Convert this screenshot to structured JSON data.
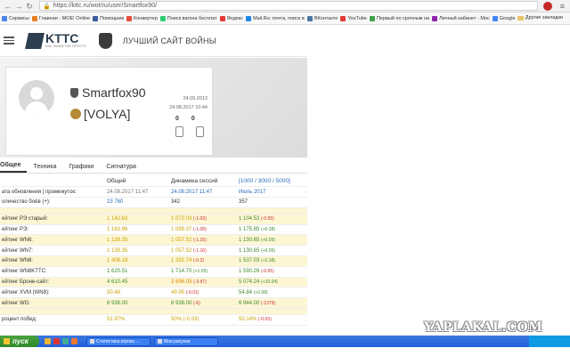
{
  "browser": {
    "url": "https://kttc.ru/wot/ru/user/Smartfox90/"
  },
  "bookmarks": [
    {
      "label": "Сервисы",
      "color": "#4a86e8"
    },
    {
      "label": "Главная - МОЕ! Online",
      "color": "#e67e22"
    },
    {
      "label": "Помощник",
      "color": "#3b5998"
    },
    {
      "label": "Конвертер",
      "color": "#e74c3c"
    },
    {
      "label": "Поиск вагона бесплат",
      "color": "#2ecc71"
    },
    {
      "label": "Яндекс",
      "color": "#e53935"
    },
    {
      "label": "Mail.Ru: почта, поиск в",
      "color": "#1e88e5"
    },
    {
      "label": "ВКонтакте",
      "color": "#4c75a3"
    },
    {
      "label": "YouTube",
      "color": "#e53935"
    },
    {
      "label": "Первый по срочным на",
      "color": "#43a047"
    },
    {
      "label": "Личный кабинет - Мос",
      "color": "#8e24aa"
    },
    {
      "label": "Google",
      "color": "#4285f4"
    }
  ],
  "bookmarks_other": "Другие закладки",
  "site": {
    "logo": "KTTC",
    "logo_sub": "КАК ТАНКИ ТАК ПРОСТО",
    "slogan": "ЛУЧШИЙ САЙТ ВОЙНЫ"
  },
  "profile": {
    "nickname": "Smartfox90",
    "clan": "[VOLYA]",
    "date_registered": "24.09.2013",
    "date_last": "24.08.2017 10:44",
    "likes": "0",
    "dislikes": "0"
  },
  "tabs": [
    "Общее",
    "Техника",
    "Графики",
    "Сигнатура"
  ],
  "stats": {
    "headers": [
      "",
      "Общий",
      "Динамика сессий",
      "[1000 / 3000 / 5000]"
    ],
    "rows": [
      {
        "label": "ата обновления | промежуток:",
        "v1": "24.08.2017 11:47",
        "v2": "24.08.2017 11:47",
        "v3": "Июль 2017",
        "cls": "",
        "c1": "grey",
        "c2": "blue",
        "c3": "blue"
      },
      {
        "label": "оличество боёв (+):",
        "v1": "23 760",
        "v2": "342",
        "v3": "357",
        "cls": "",
        "c1": "blue",
        "c2": "",
        "c3": ""
      },
      {
        "spacer": true
      },
      {
        "label": "ейтинг РЭ старый:",
        "v1": "1 142.63",
        "v2": "1 072.03",
        "d2": "(-1.03)",
        "v3": "1 104.53",
        "d3": "(-0.55)",
        "cls": "y",
        "c1": "yel",
        "c2": "yel",
        "c3": "grn"
      },
      {
        "label": "ейтинг РЭ:",
        "v1": "1 163.96",
        "v2": "1 089.37",
        "d2": "(-1.08)",
        "v3": "1 175.85",
        "d3": "(+0.38)",
        "cls": "",
        "c1": "yel",
        "c2": "yel",
        "c3": "grn"
      },
      {
        "label": "ейтинг WN6:",
        "v1": "1 139.35",
        "v2": "1 057.52",
        "d2": "(-1.16)",
        "v3": "1 130.65",
        "d3": "(+0.05)",
        "cls": "y",
        "c1": "yel",
        "c2": "yel",
        "c3": "grn"
      },
      {
        "label": "ейтинг WN7:",
        "v1": "1 139.35",
        "v2": "1 057.52",
        "d2": "(-1.16)",
        "v3": "1 130.65",
        "d3": "(+0.05)",
        "cls": "",
        "c1": "yel",
        "c2": "yel",
        "c3": "grn"
      },
      {
        "label": "ейтинг WN8:",
        "v1": "1 408.18",
        "v2": "1 392.74",
        "d2": "(-0.2)",
        "v3": "1 537.03",
        "d3": "(+2.38)",
        "cls": "y",
        "c1": "yel",
        "c2": "yel",
        "c3": "grn"
      },
      {
        "label": "ейтинг WN8KTTC:",
        "v1": "1 620.51",
        "v2": "1 714.70",
        "d2": "(+1.05)",
        "v3": "1 590.26",
        "d3": "(-0.55)",
        "cls": "",
        "c1": "grn",
        "c2": "grn",
        "c3": "grn"
      },
      {
        "label": "ейтинг Броне-сайт:",
        "v1": "4 610.45",
        "v2": "3 896.03",
        "d2": "(-3.97)",
        "v3": "5 074.24",
        "d3": "(+15.04)",
        "cls": "y",
        "c1": "grn",
        "c2": "org",
        "c3": "grn"
      },
      {
        "label": "ейтинг XVM (WN8):",
        "v1": "50.48",
        "v2": "49.95",
        "d2": "(-0.01)",
        "v3": "54.84",
        "d3": "(+0.08)",
        "cls": "",
        "c1": "yel",
        "c2": "yel",
        "c3": "grn"
      },
      {
        "label": "ейтинг WG:",
        "v1": "6 938.00",
        "v2": "6 938.00",
        "d2": "(-6)",
        "v3": "6 944.00",
        "d3": "(-1379)",
        "cls": "y",
        "c1": "grn",
        "c2": "grn",
        "c3": "grn"
      },
      {
        "spacer": true
      },
      {
        "label": "роцент побед:",
        "v1": "51.97%",
        "v2": "50% (-0.03)",
        "v3": "50.14%",
        "d3": "(-0.03)",
        "cls": "",
        "c1": "yel",
        "c2": "yel",
        "c3": "yel"
      }
    ]
  },
  "watermark": "YAPLAKAL.COM",
  "taskbar": {
    "start": "пуск",
    "tasks": [
      "Статистика игрока ...",
      "Мои рисунки"
    ]
  }
}
